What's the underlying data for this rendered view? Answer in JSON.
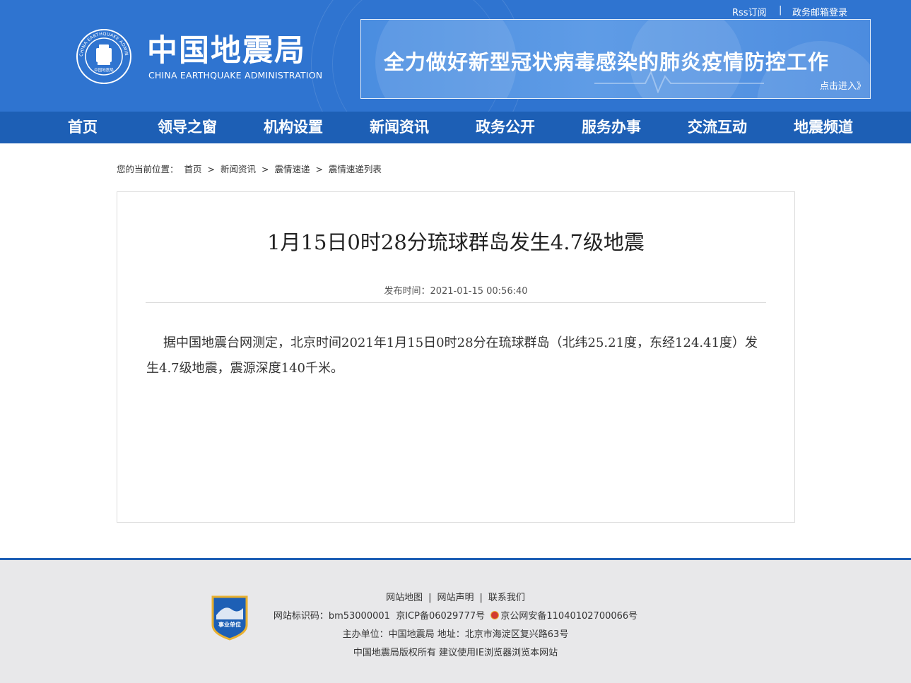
{
  "header": {
    "top_links": [
      "Rss订阅",
      "|",
      "政务邮箱登录"
    ],
    "brand_cn": "中国地震局",
    "brand_en": "CHINA EARTHQUAKE ADMINISTRATION",
    "logo_text_outer": "CHINA EARTHQUAKE ADMINISTRATION",
    "logo_text_inner": "中国地震局",
    "banner_title": "全力做好新型冠状病毒感染的肺炎疫情防控工作",
    "banner_more": "点击进入》"
  },
  "nav": [
    "首页",
    "领导之窗",
    "机构设置",
    "新闻资讯",
    "政务公开",
    "服务办事",
    "交流互动",
    "地震频道"
  ],
  "breadcrumb": {
    "label": "您的当前位置：",
    "items": [
      "首页",
      ">",
      "新闻资讯",
      ">",
      "震情速递",
      ">",
      "震情速递列表"
    ]
  },
  "article": {
    "title": "1月15日0时28分琉球群岛发生4.7级地震",
    "meta": "发布时间：2021-01-15 00:56:40",
    "body": "据中国地震台网测定，北京时间2021年1月15日0时28分在琉球群岛（北纬25.21度，东经124.41度）发生4.7级地震，震源深度140千米。"
  },
  "footer": {
    "links": [
      "网站地图",
      "网站声明",
      "联系我们"
    ],
    "line2_a": "网站标识码：bm53000001",
    "line2_b": "京ICP备06029777号",
    "line2_c": "京公网安备11040102700066号",
    "line3": "主办单位：中国地震局  地址：北京市海淀区复兴路63号",
    "line4": "中国地震局版权所有  建议使用IE浏览器浏览本网站",
    "badge_text": "事业单位"
  },
  "colors": {
    "header_bg": "#2f74d0",
    "nav_bg": "#1d5fb5",
    "footer_bg": "#e8e8ea"
  }
}
